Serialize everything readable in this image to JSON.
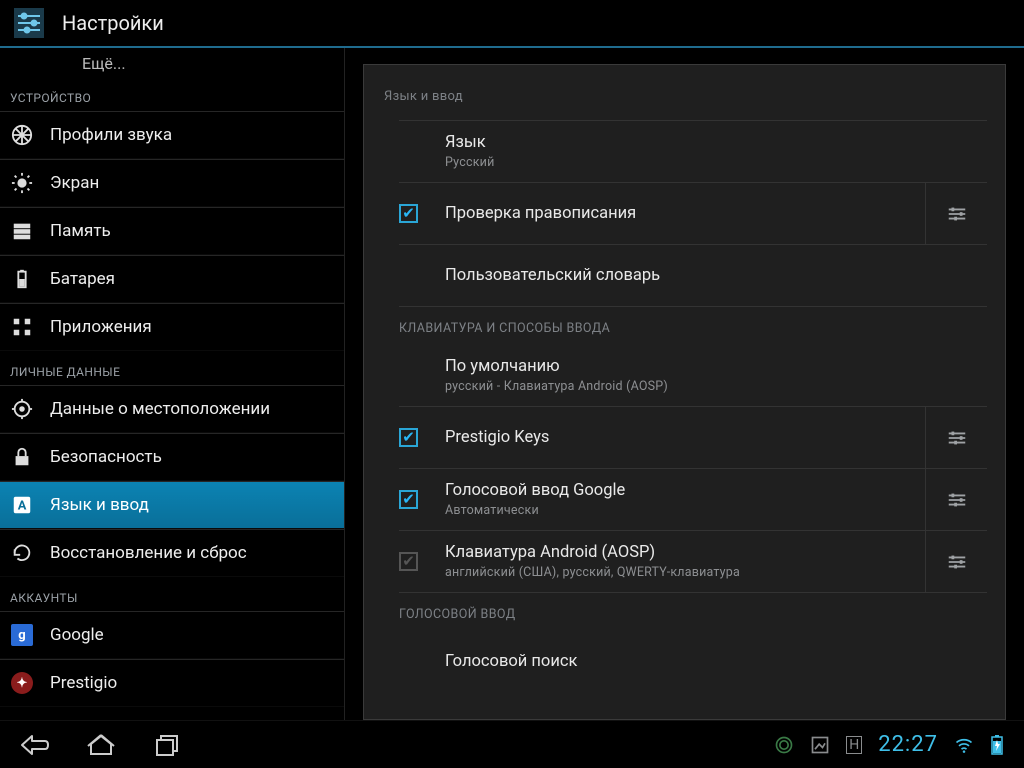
{
  "action_bar": {
    "title": "Настройки"
  },
  "sidebar": {
    "more": "Ещё...",
    "sections": {
      "device": {
        "header": "УСТРОЙСТВО"
      },
      "personal": {
        "header": "ЛИЧНЫЕ ДАННЫЕ"
      },
      "accounts": {
        "header": "АККАУНТЫ"
      }
    },
    "items": {
      "sound": "Профили звука",
      "display": "Экран",
      "storage": "Память",
      "battery": "Батарея",
      "apps": "Приложения",
      "location": "Данные о местоположении",
      "security": "Безопасность",
      "language": "Язык и ввод",
      "backup": "Восстановление и сброс",
      "google": "Google",
      "prestigio": "Prestigio"
    }
  },
  "panel": {
    "title": "Язык и ввод",
    "language": {
      "title": "Язык",
      "value": "Русский"
    },
    "spellcheck": {
      "title": "Проверка правописания"
    },
    "dictionary": {
      "title": "Пользовательский словарь"
    },
    "cat_keyboard": "КЛАВИАТУРА И СПОСОБЫ ВВОДА",
    "default": {
      "title": "По умолчанию",
      "value": "русский - Клавиатура Android (AOSP)"
    },
    "prestigio_keys": {
      "title": "Prestigio Keys"
    },
    "voice_google": {
      "title": "Голосовой ввод Google",
      "value": "Автоматически"
    },
    "aosp": {
      "title": "Клавиатура Android (AOSP)",
      "value": "английский (США), русский, QWERTY-клавиатура"
    },
    "cat_voice": "ГОЛОСОВОЙ ВВОД",
    "voice_search": {
      "title": "Голосовой поиск"
    }
  },
  "status": {
    "time": "22:27",
    "ime_indicator": "Н"
  }
}
